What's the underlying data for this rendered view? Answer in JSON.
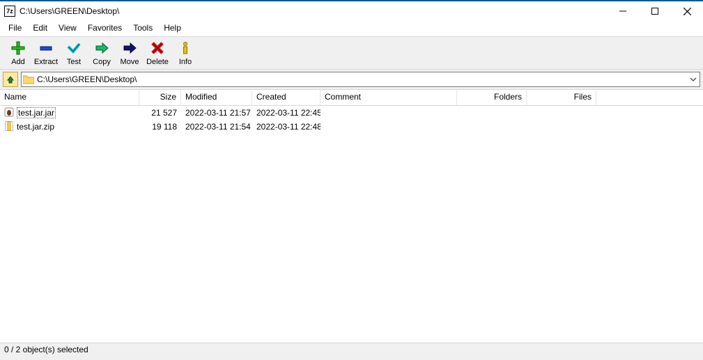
{
  "title": "C:\\Users\\GREEN\\Desktop\\",
  "menu": [
    "File",
    "Edit",
    "View",
    "Favorites",
    "Tools",
    "Help"
  ],
  "toolbar": {
    "add": "Add",
    "extract": "Extract",
    "test": "Test",
    "copy": "Copy",
    "move": "Move",
    "delete": "Delete",
    "info": "Info"
  },
  "address": {
    "path": "C:\\Users\\GREEN\\Desktop\\"
  },
  "columns": {
    "name": "Name",
    "size": "Size",
    "modified": "Modified",
    "created": "Created",
    "comment": "Comment",
    "folders": "Folders",
    "files": "Files"
  },
  "rows": [
    {
      "icon": "jar",
      "name": "test.jar.jar",
      "size": "21 527",
      "modified": "2022-03-11 21:57",
      "created": "2022-03-11 22:45",
      "comment": "",
      "folders": "",
      "files": "",
      "selected": true
    },
    {
      "icon": "zip",
      "name": "test.jar.zip",
      "size": "19 118",
      "modified": "2022-03-11 21:54",
      "created": "2022-03-11 22:48",
      "comment": "",
      "folders": "",
      "files": "",
      "selected": false
    }
  ],
  "status": "0 / 2 object(s) selected"
}
